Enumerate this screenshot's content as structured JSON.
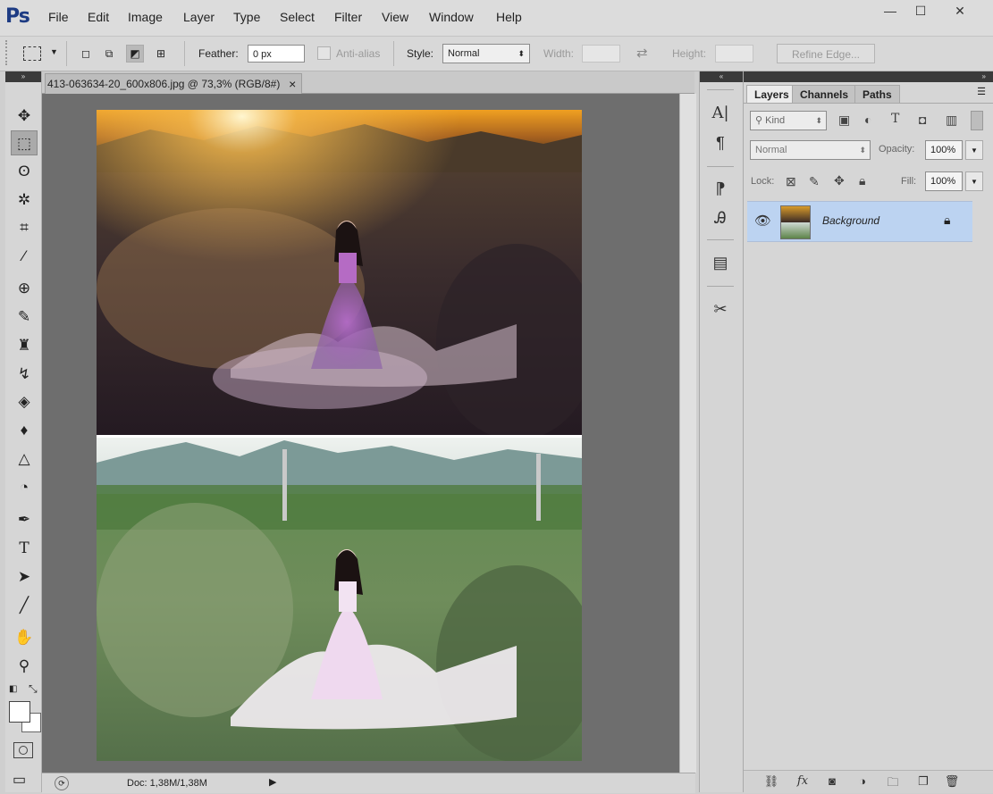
{
  "app": {
    "logo": "Ps"
  },
  "menu": [
    "File",
    "Edit",
    "Image",
    "Layer",
    "Type",
    "Select",
    "Filter",
    "View",
    "Window",
    "Help"
  ],
  "window_controls": {
    "minimize": "—",
    "maximize": "☐",
    "close": "✕"
  },
  "options": {
    "feather_label": "Feather:",
    "feather_value": "0 px",
    "antialias_label": "Anti-alias",
    "style_label": "Style:",
    "style_value": "Normal",
    "width_label": "Width:",
    "height_label": "Height:",
    "refine_edge": "Refine Edge..."
  },
  "document": {
    "tab_title": "413-063634-20_600x806.jpg @ 73,3% (RGB/8#)",
    "close": "×"
  },
  "status": {
    "doc_info": "Doc: 1,38M/1,38M"
  },
  "panel_strip": {
    "char_icon": "A|",
    "para_icon": "¶"
  },
  "layers_panel": {
    "tabs": [
      "Layers",
      "Channels",
      "Paths"
    ],
    "filter_kind": "Kind",
    "blend_mode": "Normal",
    "opacity_label": "Opacity:",
    "opacity_value": "100%",
    "lock_label": "Lock:",
    "fill_label": "Fill:",
    "fill_value": "100%",
    "layers": [
      {
        "name": "Background",
        "locked": true,
        "visible": true
      }
    ]
  },
  "colors": {
    "accent_selection": "#bcd3f1",
    "canvas_bg": "#6e6e6e",
    "ps_blue": "#1d3b83"
  }
}
